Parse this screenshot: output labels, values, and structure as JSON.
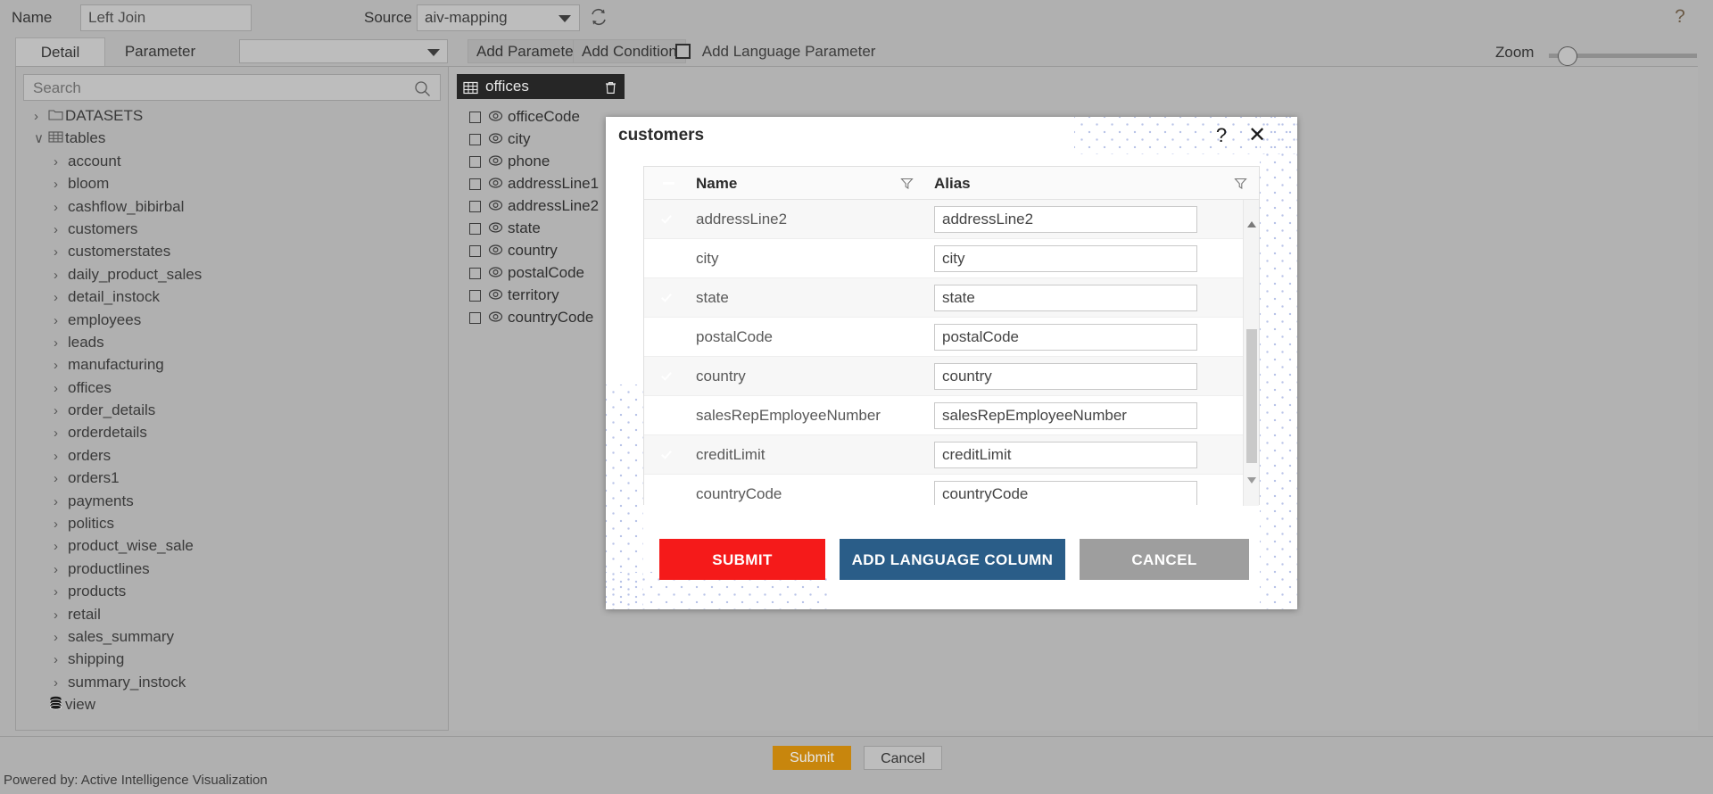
{
  "topbar": {
    "name_label": "Name",
    "name_value": "Left Join",
    "source_label": "Source",
    "source_value": "aiv-mapping",
    "refresh_icon": "refresh-icon",
    "help_icon": "help-icon"
  },
  "tabs": {
    "detail": "Detail",
    "parameter": "Parameter",
    "param_select_value": "",
    "add_parameter": "Add Parameter",
    "add_condition": "Add Condition",
    "add_language_parameter": "Add Language Parameter",
    "zoom_label": "Zoom"
  },
  "sidebar": {
    "search_placeholder": "Search",
    "search_value": "",
    "tree": [
      {
        "label": "DATASETS",
        "depth": 0,
        "chevron": "›",
        "icon": "folder-icon"
      },
      {
        "label": "tables",
        "depth": 0,
        "chevron": "∨",
        "icon": "table-icon"
      },
      {
        "label": "account",
        "depth": 1,
        "chevron": "›",
        "icon": ""
      },
      {
        "label": "bloom",
        "depth": 1,
        "chevron": "›",
        "icon": ""
      },
      {
        "label": "cashflow_bibirbal",
        "depth": 1,
        "chevron": "›",
        "icon": ""
      },
      {
        "label": "customers",
        "depth": 1,
        "chevron": "›",
        "icon": ""
      },
      {
        "label": "customerstates",
        "depth": 1,
        "chevron": "›",
        "icon": ""
      },
      {
        "label": "daily_product_sales",
        "depth": 1,
        "chevron": "›",
        "icon": ""
      },
      {
        "label": "detail_instock",
        "depth": 1,
        "chevron": "›",
        "icon": ""
      },
      {
        "label": "employees",
        "depth": 1,
        "chevron": "›",
        "icon": ""
      },
      {
        "label": "leads",
        "depth": 1,
        "chevron": "›",
        "icon": ""
      },
      {
        "label": "manufacturing",
        "depth": 1,
        "chevron": "›",
        "icon": ""
      },
      {
        "label": "offices",
        "depth": 1,
        "chevron": "›",
        "icon": ""
      },
      {
        "label": "order_details",
        "depth": 1,
        "chevron": "›",
        "icon": ""
      },
      {
        "label": "orderdetails",
        "depth": 1,
        "chevron": "›",
        "icon": ""
      },
      {
        "label": "orders",
        "depth": 1,
        "chevron": "›",
        "icon": ""
      },
      {
        "label": "orders1",
        "depth": 1,
        "chevron": "›",
        "icon": ""
      },
      {
        "label": "payments",
        "depth": 1,
        "chevron": "›",
        "icon": ""
      },
      {
        "label": "politics",
        "depth": 1,
        "chevron": "›",
        "icon": ""
      },
      {
        "label": "product_wise_sale",
        "depth": 1,
        "chevron": "›",
        "icon": ""
      },
      {
        "label": "productlines",
        "depth": 1,
        "chevron": "›",
        "icon": ""
      },
      {
        "label": "products",
        "depth": 1,
        "chevron": "›",
        "icon": ""
      },
      {
        "label": "retail",
        "depth": 1,
        "chevron": "›",
        "icon": ""
      },
      {
        "label": "sales_summary",
        "depth": 1,
        "chevron": "›",
        "icon": ""
      },
      {
        "label": "shipping",
        "depth": 1,
        "chevron": "›",
        "icon": ""
      },
      {
        "label": "summary_instock",
        "depth": 1,
        "chevron": "›",
        "icon": ""
      },
      {
        "label": "view",
        "depth": 0,
        "chevron": "",
        "icon": "database-icon"
      }
    ]
  },
  "canvas": {
    "offices_card": {
      "title": "offices",
      "delete_icon": "trash-icon",
      "fields": [
        "officeCode",
        "city",
        "phone",
        "addressLine1",
        "addressLine2",
        "state",
        "country",
        "postalCode",
        "territory",
        "countryCode"
      ]
    }
  },
  "modal": {
    "title": "customers",
    "help_icon": "help-icon",
    "close_icon": "close-icon",
    "columns": {
      "check": "select-all",
      "name": "Name",
      "alias": "Alias"
    },
    "rows": [
      {
        "checked": true,
        "name": "addressLine2",
        "alias": "addressLine2"
      },
      {
        "checked": true,
        "name": "city",
        "alias": "city"
      },
      {
        "checked": true,
        "name": "state",
        "alias": "state"
      },
      {
        "checked": true,
        "name": "postalCode",
        "alias": "postalCode"
      },
      {
        "checked": true,
        "name": "country",
        "alias": "country"
      },
      {
        "checked": true,
        "name": "salesRepEmployeeNumber",
        "alias": "salesRepEmployeeNumber"
      },
      {
        "checked": true,
        "name": "creditLimit",
        "alias": "creditLimit"
      },
      {
        "checked": true,
        "name": "countryCode",
        "alias": "countryCode"
      }
    ],
    "buttons": {
      "submit": "SUBMIT",
      "add_language_column": "ADD LANGUAGE COLUMN",
      "cancel": "CANCEL"
    }
  },
  "footer": {
    "submit": "Submit",
    "cancel": "Cancel",
    "powered_by": "Powered by: Active Intelligence Visualization"
  },
  "colors": {
    "accent_orange": "#f5a623",
    "submit_red": "#f51a1a",
    "lang_blue": "#2a5d88",
    "cancel_grey": "#9e9e9e",
    "footer_submit": "#c8860d",
    "card_header": "#262626",
    "page_bg": "#b0b0b0",
    "dot_pattern": "#b9c4e8"
  }
}
